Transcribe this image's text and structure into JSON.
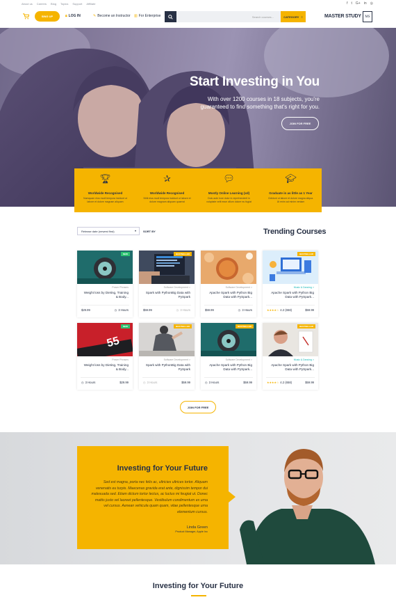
{
  "topbar": {
    "links": [
      "About us",
      "Careers",
      "Blog",
      "Topics",
      "Support",
      "Affiliate"
    ],
    "social": [
      "facebook-icon",
      "twitter-icon",
      "google-plus-icon",
      "linkedin-icon",
      "instagram-icon"
    ]
  },
  "header": {
    "signup": "SING UP",
    "login": "LOG IN",
    "instructor": "Become an Instructor",
    "enterprise": "For Enterprise",
    "search_placeholder": "Search courses...",
    "category": "CATEGORY",
    "logo": "MASTER STUDY",
    "logo_mark": "MS"
  },
  "hero": {
    "title": "Start Investing in You",
    "subtitle": "With over 1200 courses in 18 subjects, you're guaranteed to find something that's right for you.",
    "button": "JOIN FOR FREE"
  },
  "features": [
    {
      "icon": "trophy-icon",
      "title": "Worldwide Recognised",
      "desc": "Numquam eius modi tempora incidunt ut labore et dolore magnam aliquam"
    },
    {
      "icon": "stars-hand-icon",
      "title": "Worldwide Recognised",
      "desc": "Nihil eius modi tempora incidunt ut labore et dolore magnam aliquam quaerat"
    },
    {
      "icon": "chat-icon",
      "title": "Mostly Online Learning (xd)",
      "desc": "Duis aute irure dolor in reprehenderit in voluptate velit esse cillum dolore eu fugiat"
    },
    {
      "icon": "graduation-icon",
      "title": "Graduate in as little as 1 Year",
      "desc": "Cididunt ut labore et dolore magna aliqua. Ut enim ad minim veniam"
    }
  ],
  "sort": {
    "selected": "Release date (newest first)",
    "label": "SORT BY"
  },
  "section_title": "Trending Courses",
  "courses": [
    {
      "badge": "NEW",
      "category": "Power Phrases",
      "title": "Weight loss by Dieting, Training & Body...",
      "left": "$29.99",
      "right": "3 Hours"
    },
    {
      "badge": "BESTSELLER",
      "category": "Software Development >",
      "title": "Spark with PythonBig Data with PySpark",
      "left": "$59.99",
      "right": "3 Hours"
    },
    {
      "badge": "",
      "category": "Software Development >",
      "title": "Apache Spark with Python Big Data with PySpark...",
      "left": "$59.99",
      "right": "3 Hours"
    },
    {
      "badge": "BESTSELLER",
      "category": "Music & Dancing >",
      "title": "Apache Spark with Python Big Data with PySpark...",
      "left": "4.2 (658)",
      "right": "$59.99"
    },
    {
      "badge": "NEW",
      "category": "Power Phrases",
      "title": "Weight loss by Dieting, Training & Body...",
      "left": "3 Hours",
      "right": "$29.99"
    },
    {
      "badge": "BESTSELLER",
      "category": "Software Development >",
      "title": "Spark with PythonBig Data with PySpark",
      "left": "3 Hours",
      "right": "$59.99"
    },
    {
      "badge": "BESTSELLER",
      "category": "Software Development >",
      "title": "Apache Spark with Python Big Data with PySpark...",
      "left": "3 Hours",
      "right": "$59.99"
    },
    {
      "badge": "BESTSELLER",
      "category": "Music & Dancing >",
      "title": "Apache Spark with Python Big Data with PySpark...",
      "left": "4.2 (658)",
      "right": "$59.99"
    }
  ],
  "join_button": "JOIN FOR FREE",
  "testimonial": {
    "title": "Investing for Your Future",
    "quote": "Sed est magna, porta nec felis ac, ultricies ultrices tortor. Aliquam venenatis eu turpis. Maecenas gravida erat ante, dignissim tempor dui malesuada sed. Etiam dictum tortor lectus, ac luctus mi feugiat ut. Donec mattis justo vel laoreet pellentesque. Vestibulum condimentum ex urna vel cursus. Aenean vehicula quam quam, vitae pellentesque urna elementum cursus.",
    "name": "Linda Green",
    "role": "Product Manager, Apple Inc"
  },
  "bottom_title": "Investing for Your Future"
}
